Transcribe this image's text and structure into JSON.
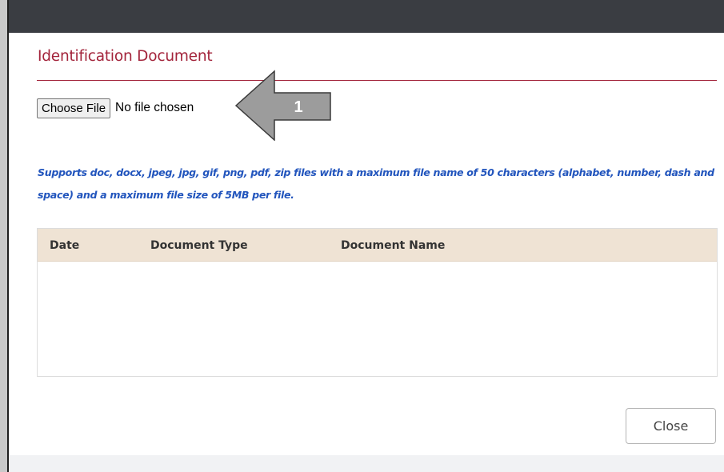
{
  "modal": {
    "title": "Identification Document",
    "file_input": {
      "button_label": "Choose File",
      "status_text": "No file chosen"
    },
    "callout": {
      "number": "1",
      "icon": "left-arrow-icon",
      "color": "#999999"
    },
    "supports_note": "Supports doc, docx, jpeg, jpg, gif, png, pdf, zip files with a maximum file name of 50 characters (alphabet, number, dash and space) and a maximum file size of 5MB per file.",
    "table": {
      "columns": [
        "Date",
        "Document Type",
        "Document Name"
      ],
      "rows": []
    },
    "close_label": "Close"
  },
  "colors": {
    "title": "#a3243b",
    "note": "#2255bd",
    "table_header_bg": "#efe3d4",
    "topbar": "#3a3d42"
  }
}
